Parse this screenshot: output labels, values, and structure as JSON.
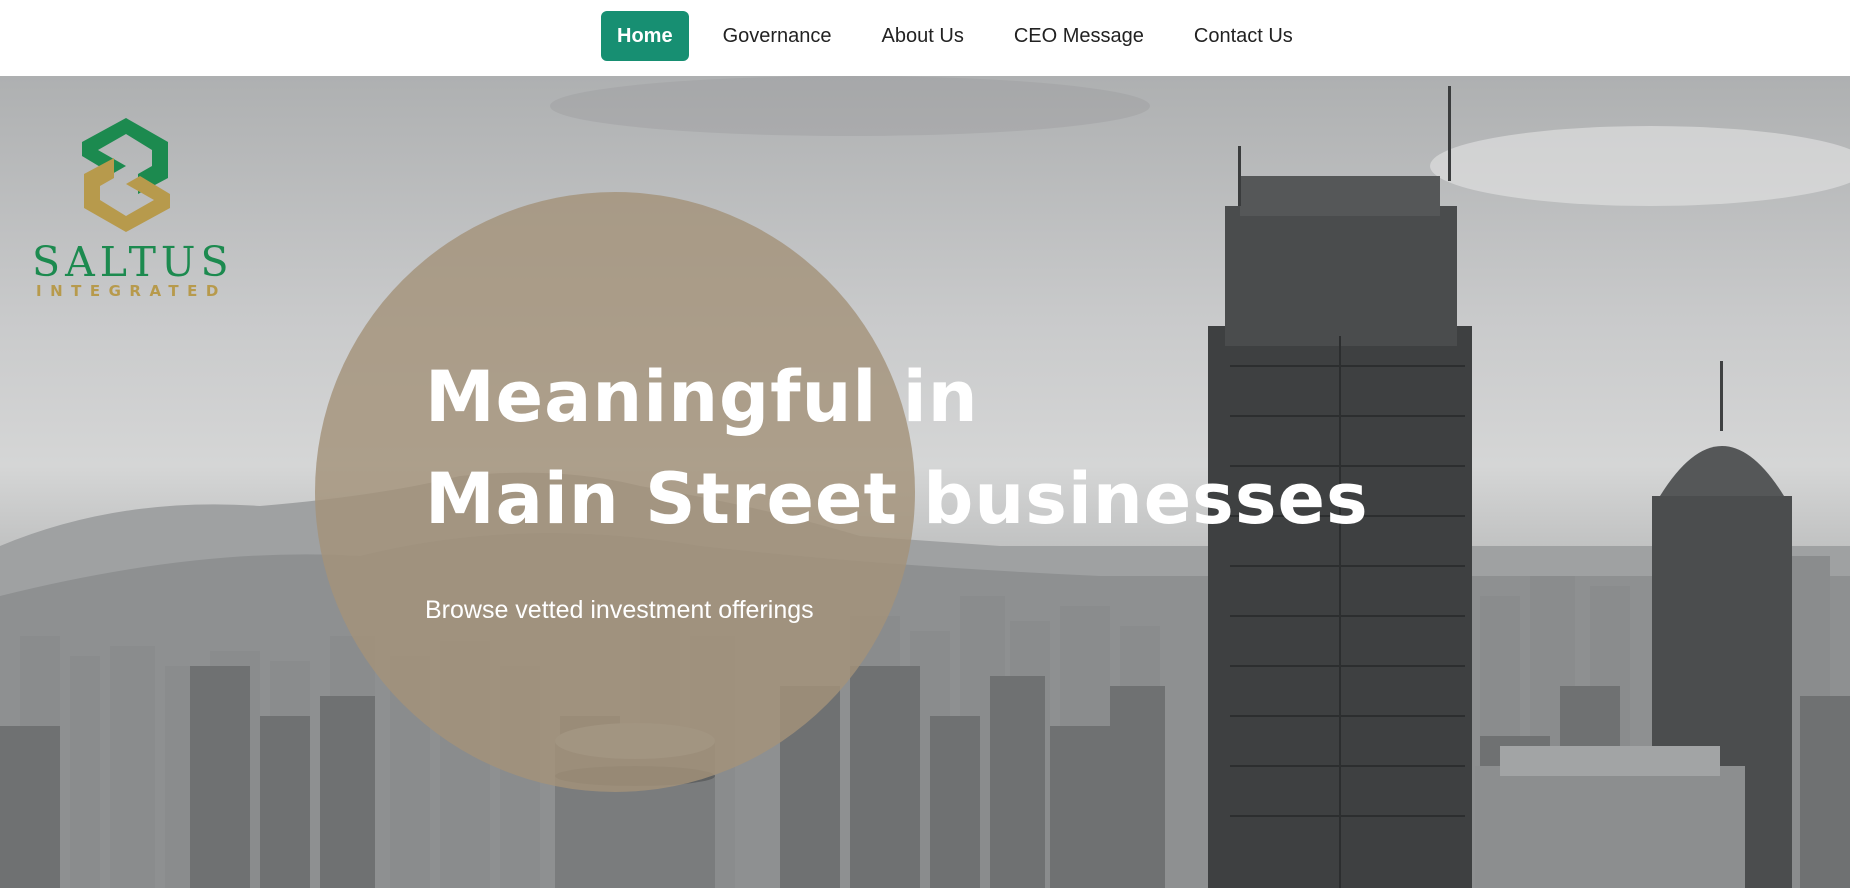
{
  "nav": {
    "items": [
      {
        "label": "Home",
        "active": true
      },
      {
        "label": "Governance",
        "active": false
      },
      {
        "label": "About Us",
        "active": false
      },
      {
        "label": "CEO Message",
        "active": false
      },
      {
        "label": "Contact Us",
        "active": false
      }
    ]
  },
  "logo": {
    "name": "SALTUS",
    "tagline": "INTEGRATED",
    "colors": {
      "green": "#1c8a4f",
      "gold": "#b79a4c"
    }
  },
  "hero": {
    "headline_line1": "Meaningful in",
    "headline_line2": "Main Street businesses",
    "subheadline": "Browse vetted investment offerings",
    "background_icon": "city-skyline-photo",
    "accent_circle_color": "#a4937a"
  },
  "colors": {
    "nav_active": "#178f72",
    "nav_text": "#222222"
  }
}
